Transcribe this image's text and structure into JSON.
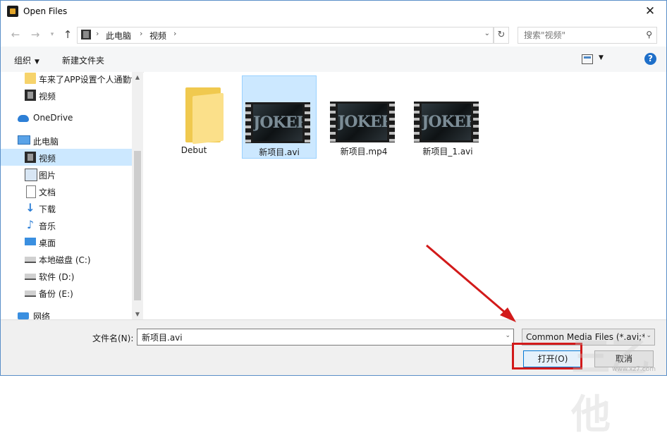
{
  "window": {
    "title": "Open Files",
    "close_glyph": "✕"
  },
  "address": {
    "crumbs": [
      "此电脑",
      "视频"
    ],
    "search_placeholder": "搜索\"视频\""
  },
  "toolbar": {
    "organize": "组织",
    "new_folder": "新建文件夹",
    "help": "?"
  },
  "sidebar": {
    "items": [
      {
        "label": "车来了APP设置个人通勤f",
        "icon": "folder-icon"
      },
      {
        "label": "视频",
        "icon": "video-icon"
      },
      {
        "label": "OneDrive",
        "icon": "cloud-icon"
      },
      {
        "label": "此电脑",
        "icon": "pc-icon"
      },
      {
        "label": "视频",
        "icon": "video-icon",
        "selected": true
      },
      {
        "label": "图片",
        "icon": "picture-icon"
      },
      {
        "label": "文档",
        "icon": "document-icon"
      },
      {
        "label": "下载",
        "icon": "download-icon"
      },
      {
        "label": "音乐",
        "icon": "music-icon"
      },
      {
        "label": "桌面",
        "icon": "desktop-icon"
      },
      {
        "label": "本地磁盘 (C:)",
        "icon": "disk-icon"
      },
      {
        "label": "软件 (D:)",
        "icon": "disk-icon"
      },
      {
        "label": "备份 (E:)",
        "icon": "disk-icon"
      },
      {
        "label": "网络",
        "icon": "network-icon"
      }
    ]
  },
  "files": [
    {
      "name": "Debut",
      "type": "folder"
    },
    {
      "name": "新项目.avi",
      "type": "video",
      "selected": true,
      "thumb_text": "JOKER"
    },
    {
      "name": "新项目.mp4",
      "type": "video",
      "thumb_text": "JOKER"
    },
    {
      "name": "新项目_1.avi",
      "type": "video",
      "thumb_text": "JOKER"
    }
  ],
  "bottom": {
    "filename_label": "文件名(N):",
    "filename_value": "新项目.avi",
    "filetype": "Common Media Files (*.avi;*",
    "open_label": "打开(O)",
    "cancel_label": "取消"
  },
  "watermark": {
    "glyphs": "三乙他",
    "url": "www.xz7.com"
  },
  "colors": {
    "accent": "#0078d7",
    "selection": "#cce8ff",
    "annotation_red": "#d21a1a"
  }
}
